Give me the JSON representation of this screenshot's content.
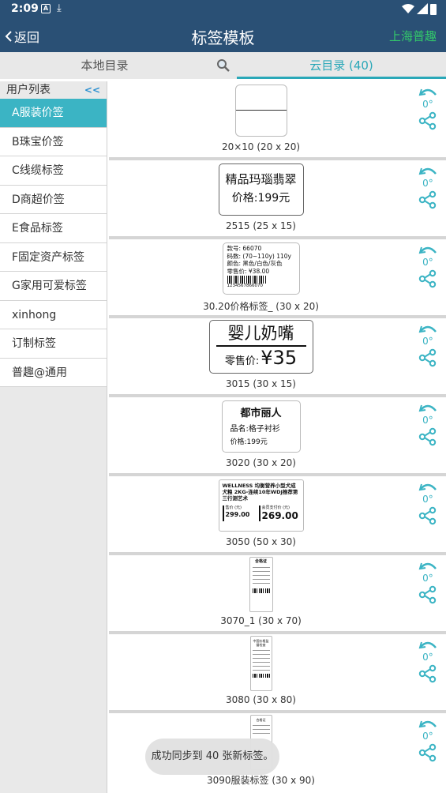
{
  "status": {
    "time": "2:09"
  },
  "appbar": {
    "back_label": "返回",
    "title": "标签模板",
    "brand": "上海普趣"
  },
  "tabs": {
    "local": "本地目录",
    "cloud": "云目录 (40)"
  },
  "sidebar": {
    "header": "用户列表",
    "collapse": "<<",
    "items": [
      {
        "label": "A服装价签"
      },
      {
        "label": "B珠宝价签"
      },
      {
        "label": "C线缆标签"
      },
      {
        "label": "D商超价签"
      },
      {
        "label": "E食品标签"
      },
      {
        "label": "F固定资产标签"
      },
      {
        "label": "G家用可爱标签"
      },
      {
        "label": "xinhong"
      },
      {
        "label": "订制标签"
      },
      {
        "label": "普趣@通用"
      }
    ]
  },
  "rotation_label": "0°",
  "templates": [
    {
      "caption": "20×10 (20 x 20)"
    },
    {
      "caption": "2515 (25 x 15)",
      "line1": "精品玛瑙翡翠",
      "line2": "价格:199元"
    },
    {
      "caption": "30.20价格标签_ (30 x 20)",
      "r1": "款号: 66070",
      "r2": "码数: (70~110y) 110y",
      "r3": "颜色: 黑色/白色/灰色",
      "r4": "零售价: ¥38.00",
      "barcode_num": "1234567866070"
    },
    {
      "caption": "3015 (30 x 15)",
      "line1": "婴儿奶嘴",
      "price_label": "零售价:",
      "price": "¥35"
    },
    {
      "caption": "3020 (30 x 20)",
      "line1": "都市丽人",
      "line2": "品名:格子衬衫",
      "line3": "价格:199元"
    },
    {
      "caption": "3050 (50 x 30)",
      "line1": "WELLNESS 均衡营养小型犬成",
      "line2": "犬粮 2KG-连续10年WDJ推荐第",
      "line3": "三行测艺术",
      "p1_label": "售价 (元)",
      "p1": "299.00",
      "p2_label": "会员支付价 (元)",
      "p2": "269.00"
    },
    {
      "caption": "3070_1 (30 x 70)",
      "head": "合格证"
    },
    {
      "caption": "3080 (30 x 80)",
      "head": "中国价格监督检查"
    },
    {
      "caption": "3090服装标签 (30 x 90)",
      "head": "合格证"
    }
  ],
  "toast": "成功同步到 40 张新标签。",
  "colors": {
    "appbar": "#2a5075",
    "accent": "#3bb4c4",
    "brand": "#33c86a",
    "link": "#2a8fd0"
  },
  "icons": [
    "back-chevron-icon",
    "search-icon",
    "rotate-icon",
    "share-icon",
    "wifi-icon",
    "signal-icon",
    "battery-icon",
    "download-icon"
  ]
}
